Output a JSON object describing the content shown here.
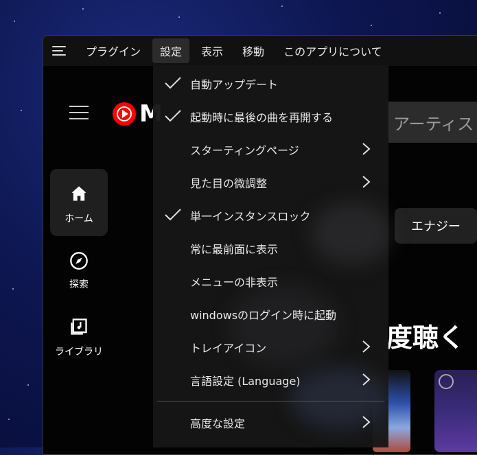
{
  "menubar": {
    "items": [
      {
        "label": "プラグイン"
      },
      {
        "label": "設定"
      },
      {
        "label": "表示"
      },
      {
        "label": "移動"
      },
      {
        "label": "このアプリについて"
      }
    ]
  },
  "settings_menu": {
    "items": [
      {
        "label": "自動アップデート",
        "checked": true,
        "submenu": false
      },
      {
        "label": "起動時に最後の曲を再開する",
        "checked": true,
        "submenu": false
      },
      {
        "label": "スターティングページ",
        "checked": false,
        "submenu": true
      },
      {
        "label": "見た目の微調整",
        "checked": false,
        "submenu": true
      },
      {
        "label": "単一インスタンスロック",
        "checked": true,
        "submenu": false
      },
      {
        "label": "常に最前面に表示",
        "checked": false,
        "submenu": false
      },
      {
        "label": "メニューの非表示",
        "checked": false,
        "submenu": false
      },
      {
        "label": "windowsのログイン時に起動",
        "checked": false,
        "submenu": false
      },
      {
        "label": "トレイアイコン",
        "checked": false,
        "submenu": true
      },
      {
        "label": "言語設定 (Language)",
        "checked": false,
        "submenu": true
      },
      {
        "label": "高度な設定",
        "checked": false,
        "submenu": true
      }
    ]
  },
  "app": {
    "logo_letter": "M",
    "search_text": "アーティス",
    "nav": {
      "home": "ホーム",
      "explore": "探索",
      "library": "ライブラリ"
    },
    "chip": "エナジー",
    "section_title_partial": "度聴く"
  },
  "colors": {
    "brand_red": "#ff0000",
    "menu_bg": "#161616",
    "active_menu_bg": "#2b2b2b"
  }
}
